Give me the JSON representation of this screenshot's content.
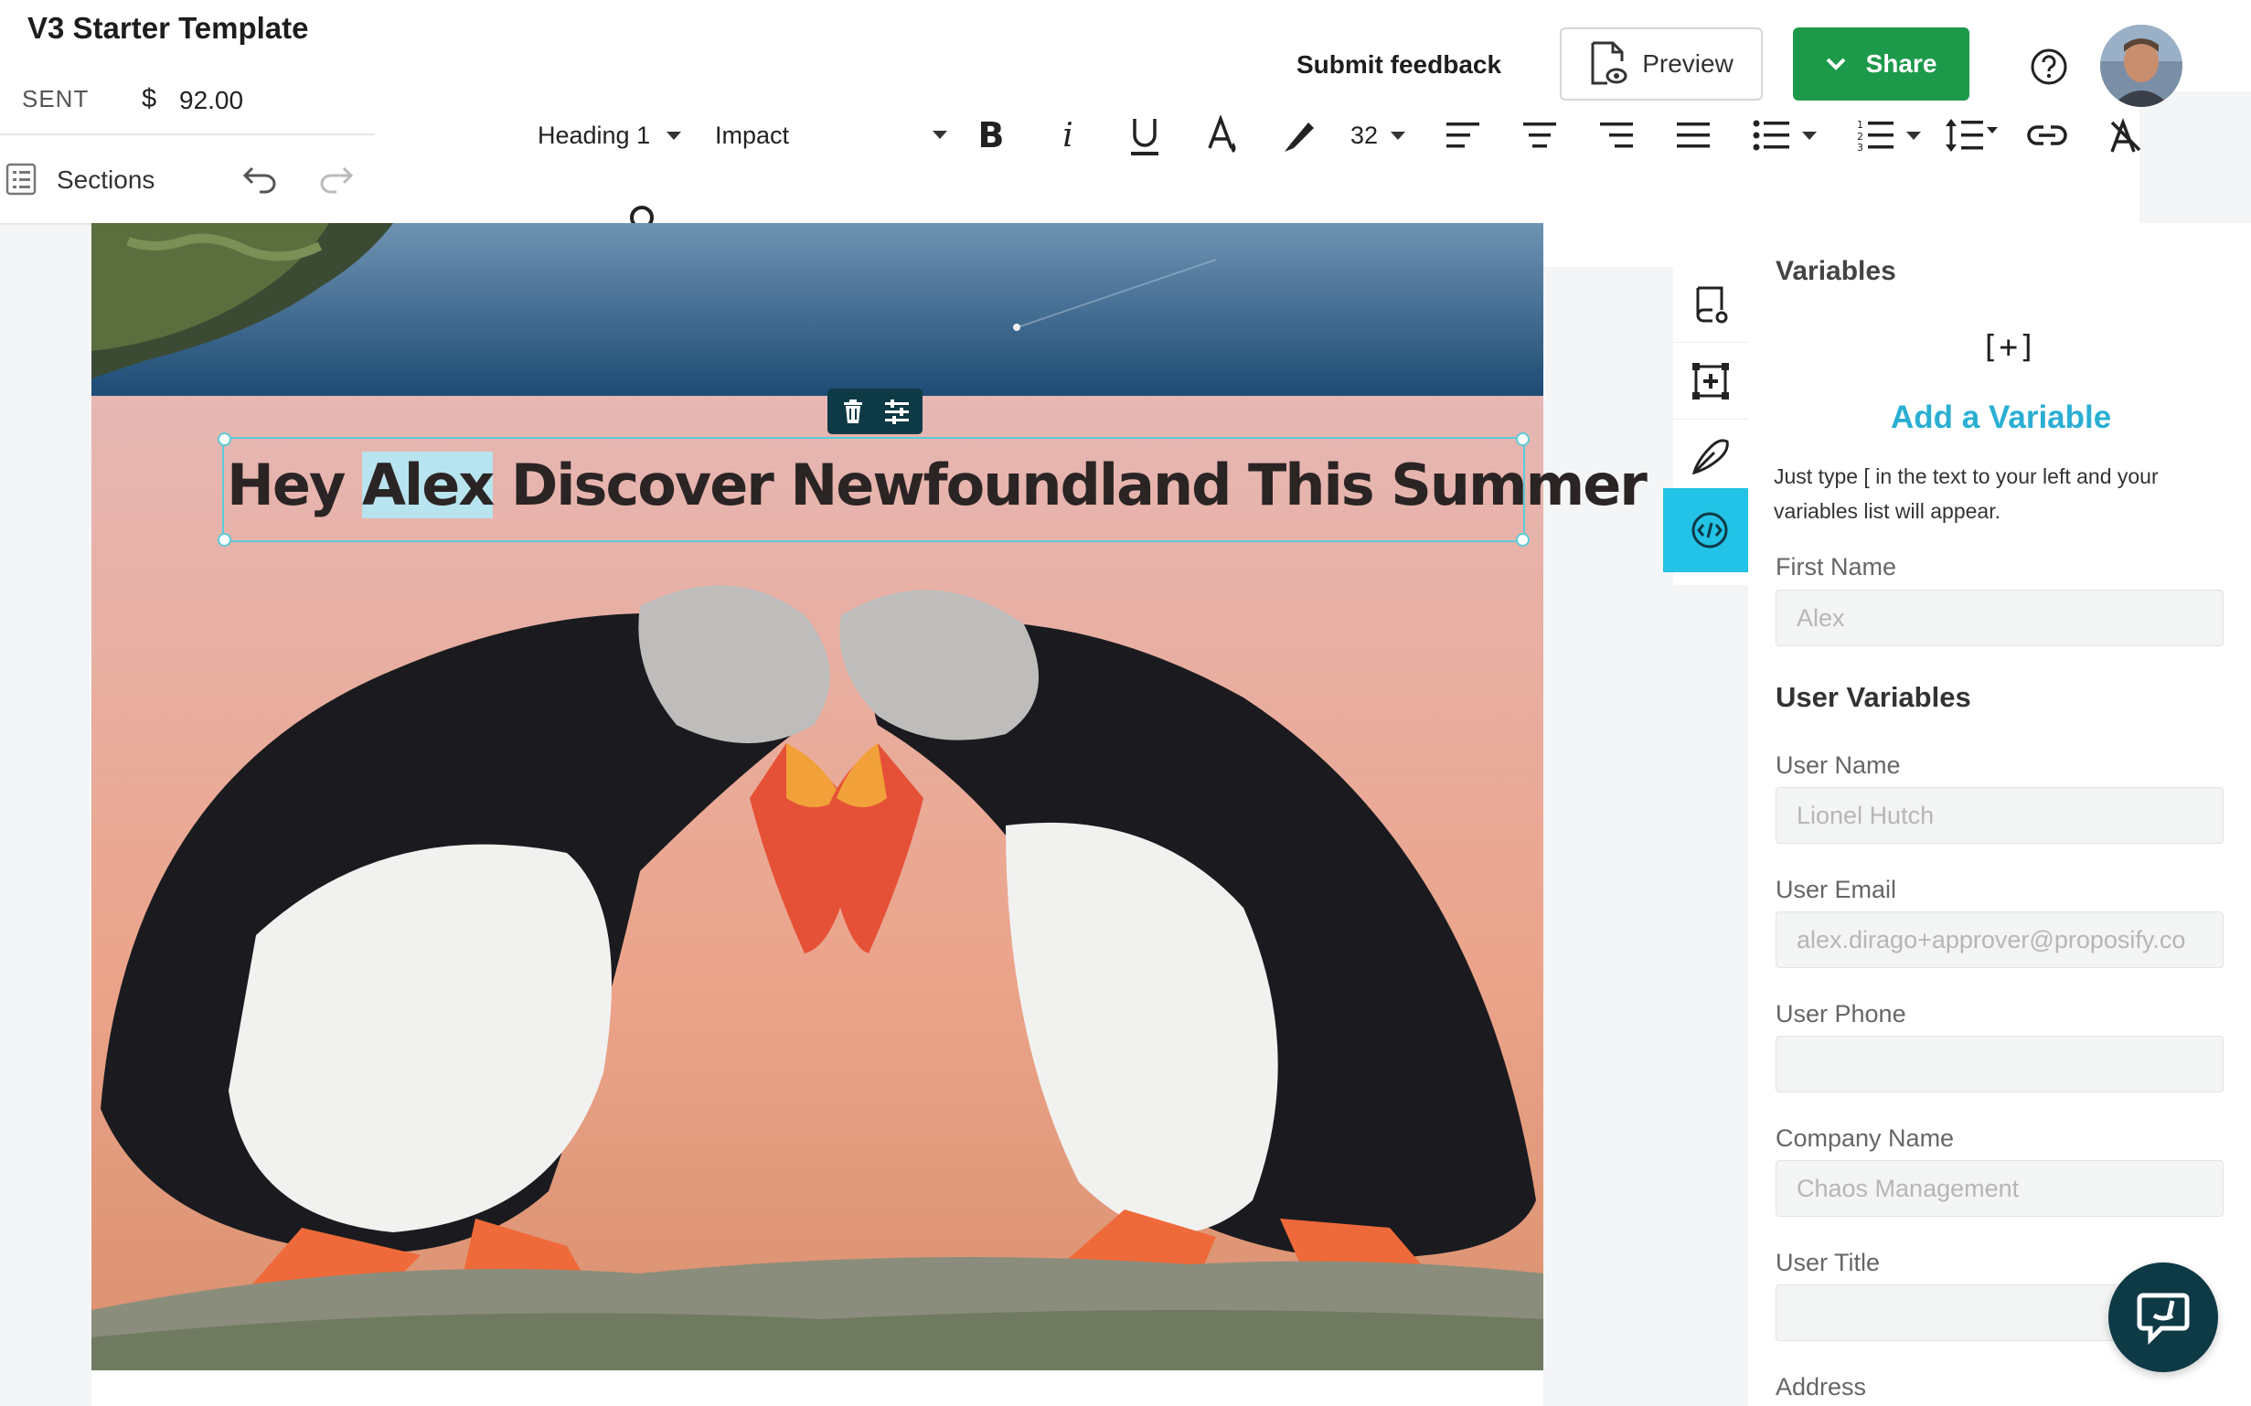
{
  "header": {
    "doc_title": "V3 Starter Template",
    "status": "SENT",
    "currency": "$",
    "amount": "92.00",
    "sections_label": "Sections",
    "submit_feedback": "Submit feedback",
    "preview_label": "Preview",
    "share_label": "Share"
  },
  "toolbar": {
    "block_style": "Heading 1",
    "font_family": "Impact",
    "font_size": "32",
    "icons": [
      "bold-icon",
      "italic-icon",
      "underline-icon",
      "text-color-icon",
      "highlight-icon",
      "align-left-icon",
      "align-center-icon",
      "align-right-icon",
      "justify-icon",
      "bullet-list-icon",
      "numbered-list-icon",
      "line-height-icon",
      "link-icon",
      "clear-format-icon",
      "search-icon"
    ]
  },
  "canvas": {
    "heading_prefix": "Hey ",
    "heading_name": "Alex",
    "heading_suffix": " Discover Newfoundland This Summer"
  },
  "panel": {
    "title": "Variables",
    "add_variable_icon": "[+]",
    "add_variable": "Add a Variable",
    "help_text": "Just type [ in the text to your left and your variables list will appear.",
    "first_name_label": "First Name",
    "first_name_value": "Alex",
    "user_variables_title": "User Variables",
    "fields": [
      {
        "label": "User Name",
        "value": "Lionel Hutch"
      },
      {
        "label": "User Email",
        "value": "alex.dirago+approver@proposify.co"
      },
      {
        "label": "User Phone",
        "value": ""
      },
      {
        "label": "Company Name",
        "value": "Chaos Management"
      },
      {
        "label": "User Title",
        "value": ""
      },
      {
        "label": "Address",
        "value": ""
      }
    ]
  },
  "colors": {
    "accent": "#22c3e6",
    "share_green": "#1c9a4a",
    "link_blue": "#2aafd3",
    "dark_teal": "#0e3a46",
    "selection_highlight": "#b7e4ef"
  }
}
